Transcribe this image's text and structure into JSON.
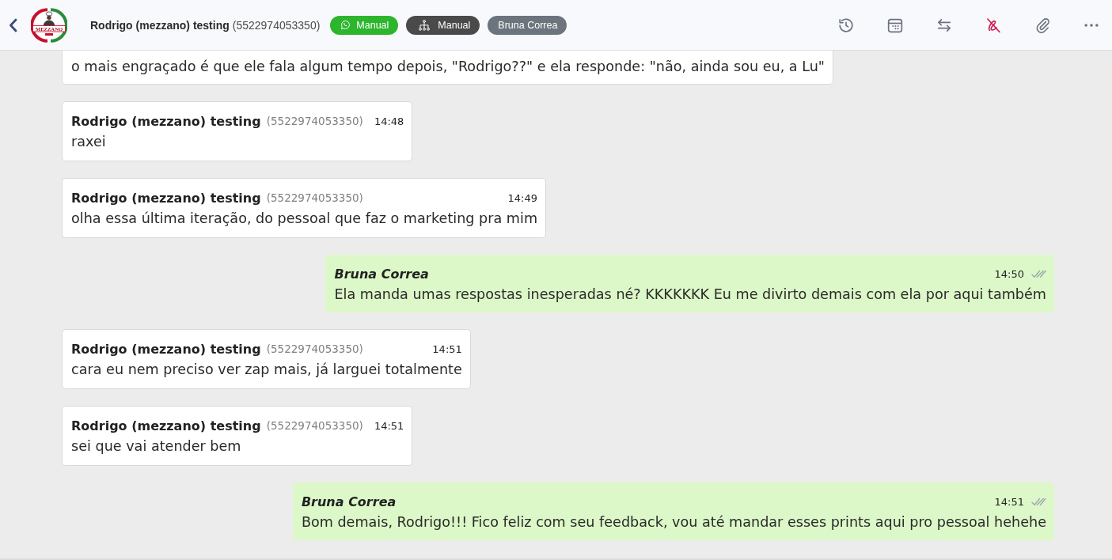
{
  "header": {
    "contact_name": "Rodrigo (mezzano) testing",
    "contact_phone": "(5522974053350)",
    "logo_text": "MEZZANO",
    "tags": [
      {
        "kind": "channel",
        "label": "Manual",
        "color": "#2db52d"
      },
      {
        "kind": "flow",
        "label": "Manual",
        "color": "#4a4a4a"
      },
      {
        "kind": "agent",
        "label": "Bruna Correa",
        "color": "#6c757d"
      }
    ],
    "actions": [
      {
        "kind": "history",
        "color": "#6b7280"
      },
      {
        "kind": "calendar",
        "color": "#6b7280"
      },
      {
        "kind": "transfer",
        "color": "#6b7280"
      },
      {
        "kind": "signature",
        "color": "#d1184c"
      },
      {
        "kind": "attach",
        "color": "#6b7280"
      },
      {
        "kind": "more",
        "color": "#6b7280"
      }
    ]
  },
  "messages": [
    {
      "kind": "incoming",
      "text": "o mais engraçado é que ele fala algum tempo depois, \"Rodrigo??\" e ela responde: \"não, ainda sou eu, a Lu\""
    },
    {
      "kind": "incoming",
      "sender": "Rodrigo (mezzano) testing",
      "phone": "(5522974053350)",
      "time": "14:48",
      "text": "raxei"
    },
    {
      "kind": "incoming",
      "sender": "Rodrigo (mezzano) testing",
      "phone": "(5522974053350)",
      "time": "14:49",
      "text": "olha essa última iteração, do pessoal que faz o marketing pra mim"
    },
    {
      "kind": "outgoing",
      "sender": "Bruna Correa",
      "time": "14:50",
      "read": false,
      "text": "Ela manda umas respostas inesperadas né? KKKKKKK Eu me divirto demais com ela por aqui também"
    },
    {
      "kind": "incoming",
      "sender": "Rodrigo (mezzano) testing",
      "phone": "(5522974053350)",
      "time": "14:51",
      "text": "cara eu nem preciso ver zap mais, já larguei totalmente"
    },
    {
      "kind": "incoming",
      "sender": "Rodrigo (mezzano) testing",
      "phone": "(5522974053350)",
      "time": "14:51",
      "text": "sei que vai atender bem"
    },
    {
      "kind": "outgoing",
      "sender": "Bruna Correa",
      "time": "14:51",
      "read": false,
      "text": "Bom demais, Rodrigo!!! Fico feliz com seu feedback, vou até mandar esses prints aqui pro pessoal hehehe"
    }
  ]
}
